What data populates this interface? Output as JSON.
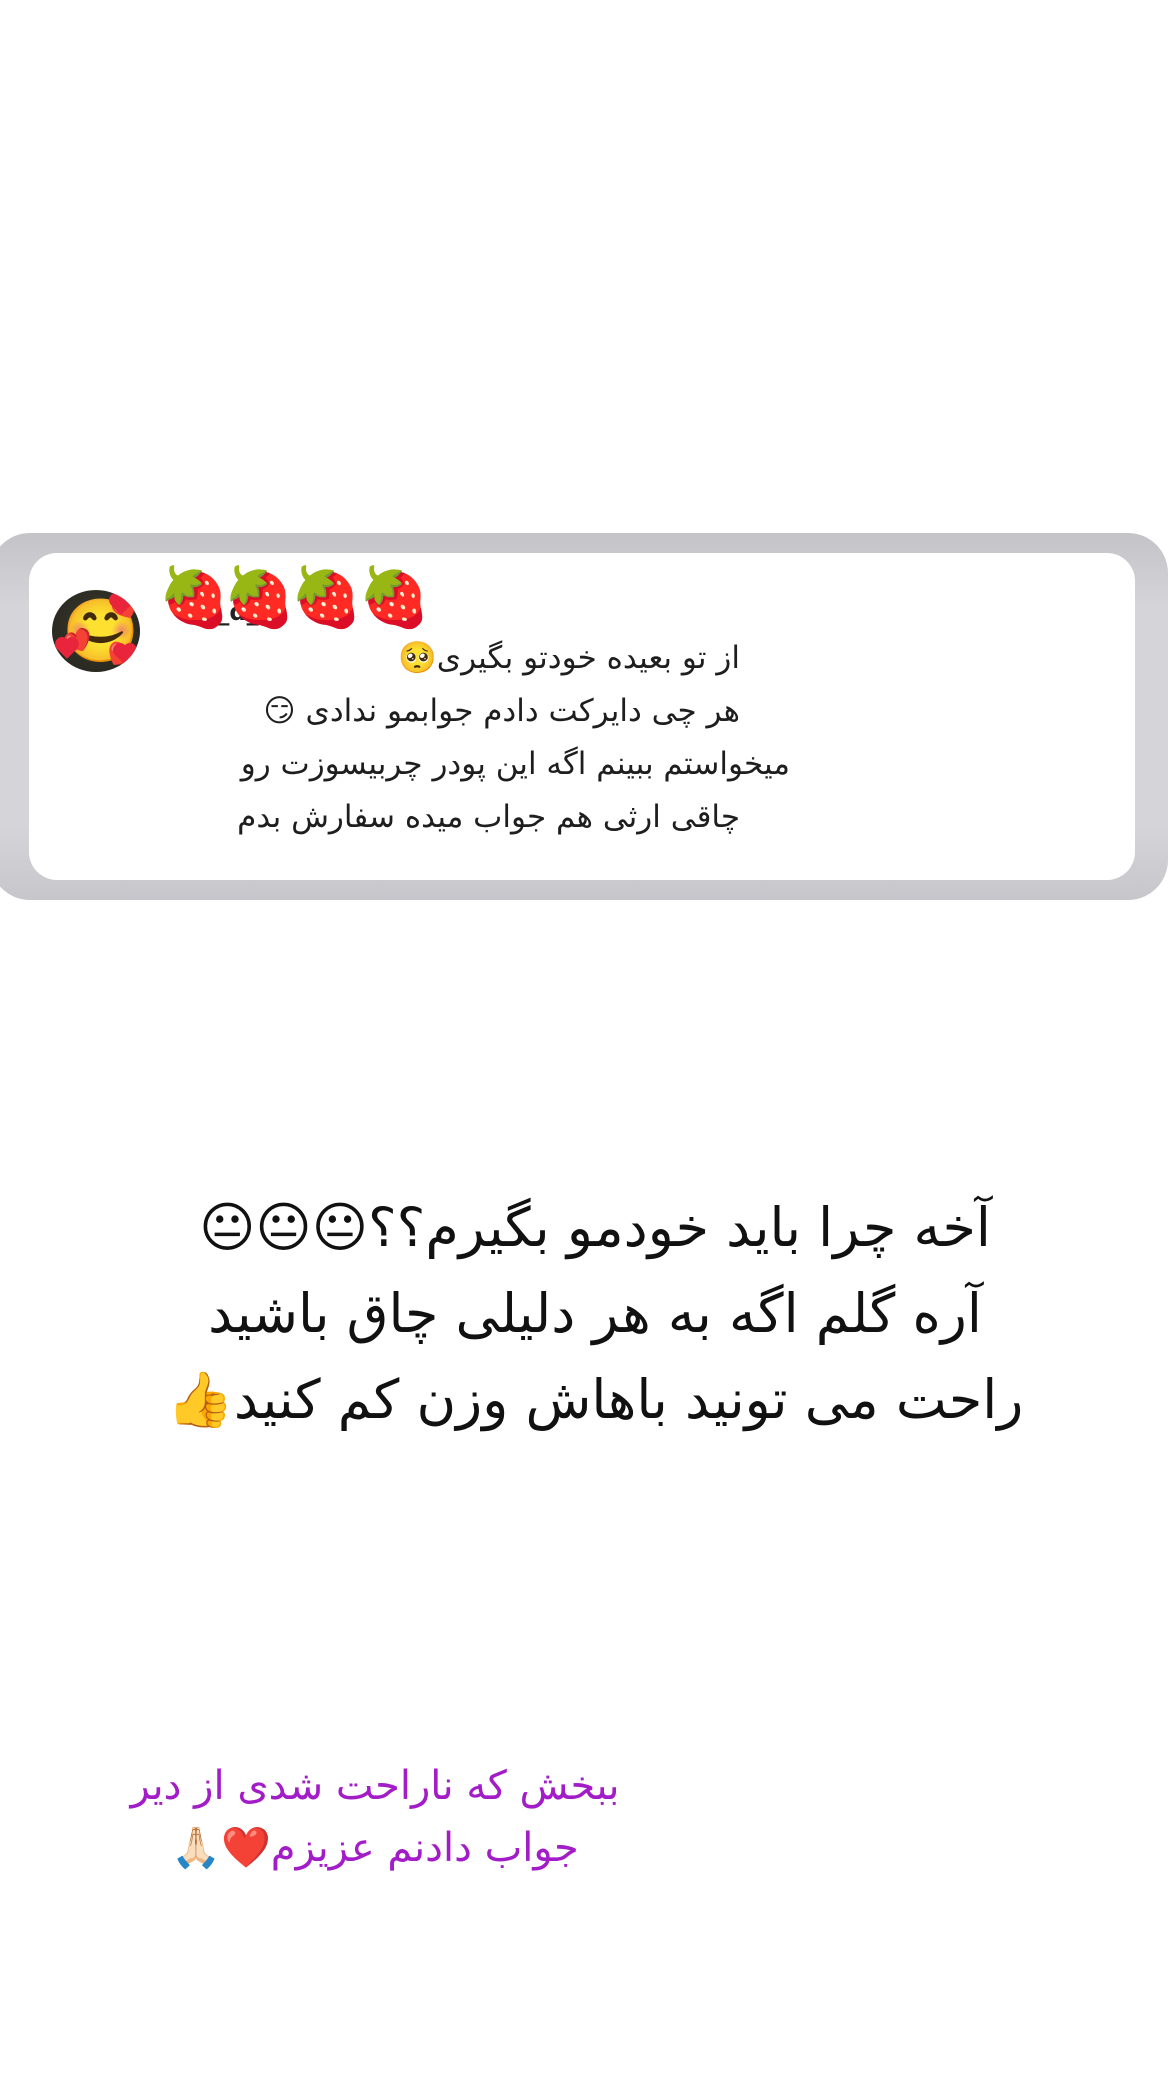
{
  "dm_card": {
    "username": "ia_d_",
    "emoji_row": "🍓🍓🍓🍓",
    "avatar_emoji": "🥰",
    "lines": [
      "از تو بعیده خودتو بگیری🥺",
      "هر چی دایرکت دادم جوابمو ندادی 😏",
      "میخواستم ببینم اگه این پودر چربیسوزت رو",
      "چاقی ارثی هم جواب میده سفارش بدم"
    ]
  },
  "reply": {
    "lines": [
      "آخه چرا باید خودمو بگیرم؟؟😐😐😐",
      "آره گلم اگه به هر دلیلی چاق باشید",
      "راحت می تونید باهاش وزن کم کنید👍"
    ]
  },
  "apology": {
    "lines": [
      "ببخش که ناراحت شدی از دیر",
      "جواب دادنم عزیزم❤️🙏🏻"
    ],
    "color": "#a21cc7"
  },
  "colors": {
    "background": "#ffffff",
    "card_frame": "#d4d4d9",
    "text": "#111111"
  }
}
